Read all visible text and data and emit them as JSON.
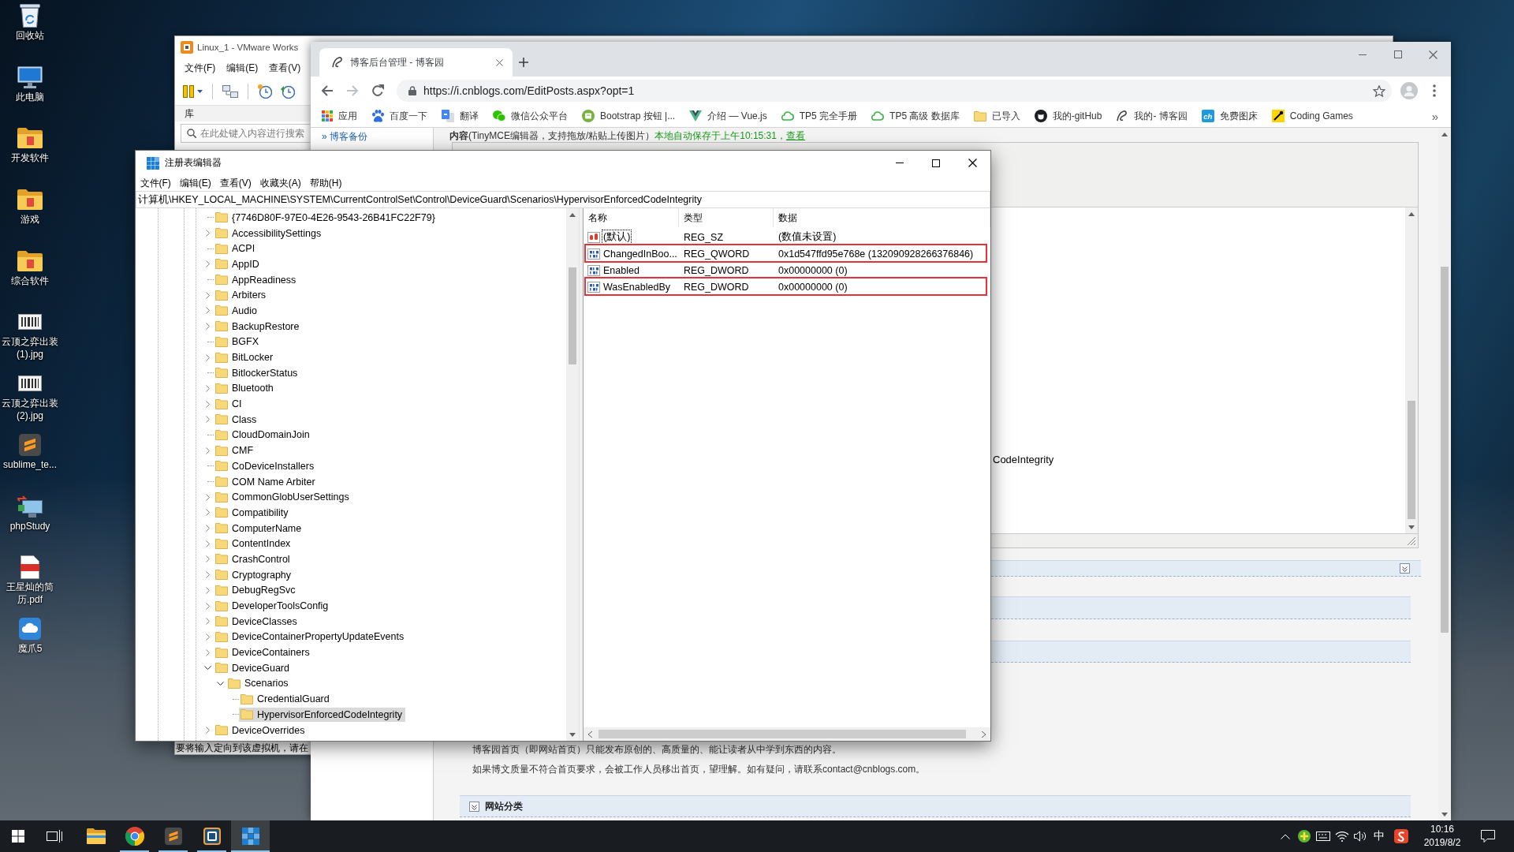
{
  "desktop": {
    "icons": [
      {
        "label": "回收站",
        "kind": "bin"
      },
      {
        "label": "此电脑",
        "kind": "computer"
      },
      {
        "label": "开发软件",
        "kind": "folder"
      },
      {
        "label": "游戏",
        "kind": "folder"
      },
      {
        "label": "综合软件",
        "kind": "folder"
      },
      {
        "label": "云顶之弈出装(1).jpg",
        "kind": "image"
      },
      {
        "label": "云顶之弈出装(2).jpg",
        "kind": "image"
      },
      {
        "label": "sublime_te...",
        "kind": "sublime"
      },
      {
        "label": "phpStudy",
        "kind": "phpstudy"
      },
      {
        "label": "王星灿的简历.pdf",
        "kind": "pdf"
      },
      {
        "label": "魔爪5",
        "kind": "cloud"
      }
    ]
  },
  "vmware": {
    "title": "Linux_1 - VMware Works",
    "menu": [
      "文件(F)",
      "编辑(E)",
      "查看(V)"
    ],
    "library_title": "库",
    "search": {
      "placeholder": "在此处键入内容进行搜索"
    },
    "status": "要将输入定向到该虚拟机，请在"
  },
  "browser": {
    "tabs": [
      {
        "title": "博客后台管理 - 博客园",
        "selected": true
      }
    ],
    "nav": [
      {
        "kind": "back",
        "disabled": false
      },
      {
        "kind": "forward",
        "disabled": true
      },
      {
        "kind": "reload",
        "disabled": false
      }
    ],
    "url": "https://i.cnblogs.com/EditPosts.aspx?opt=1",
    "bookmarks": [
      {
        "label": "应用",
        "kind": "apps"
      },
      {
        "label": "百度一下",
        "kind": "paw"
      },
      {
        "label": "翻译",
        "kind": "translate"
      },
      {
        "label": "微信公众平台",
        "kind": "chat"
      },
      {
        "label": "Bootstrap 按钮 |...",
        "kind": "page"
      },
      {
        "label": "介绍 — Vue.js",
        "kind": "vee"
      },
      {
        "label": "TP5 完全手册",
        "kind": "cloud"
      },
      {
        "label": "TP5 高级 数据库",
        "kind": "cloud"
      },
      {
        "label": "已导入",
        "kind": "folder"
      },
      {
        "label": "我的-gitHub",
        "kind": "cat"
      },
      {
        "label": "我的- 博客园",
        "kind": "site"
      },
      {
        "label": "免费图床",
        "kind": "tile",
        "icon_text": "ch"
      },
      {
        "label": "Coding Games",
        "kind": "pin"
      }
    ],
    "more_bookmarks": "»",
    "page": {
      "sidebar_links": [
        "» 博客备份"
      ],
      "editor_label": "**内容**(TinyMCE编辑器，支持拖放/粘贴上传图片）",
      "autosave_note": "本地自动保存于上午10:15:31，",
      "autosave_link": "查看",
      "editor_text": "CodeIntegrity",
      "notices": [
        "博客园首页（即网站首页）只能发布原创的、高质量的、能让读者从中学到东西的内容。",
        "如果博文质量不符合首页要求，会被工作人员移出首页，望理解。如有疑问，请联系contact@cnblogs.com。"
      ],
      "category_title": "网站分类"
    }
  },
  "regedit": {
    "title": "注册表编辑器",
    "menu": [
      "文件(F)",
      "编辑(E)",
      "查看(V)",
      "收藏夹(A)",
      "帮助(H)"
    ],
    "address": "计算机\\HKEY_LOCAL_MACHINE\\SYSTEM\\CurrentControlSet\\Control\\DeviceGuard\\Scenarios\\HypervisorEnforcedCodeIntegrity",
    "tree": [
      {
        "name": "{7746D80F-97E0-4E26-9543-26B41FC22F79}",
        "expandable": false,
        "selected": false
      },
      {
        "name": "AccessibilitySettings",
        "expandable": true,
        "expanded": false,
        "selected": false
      },
      {
        "name": "ACPI",
        "expandable": false,
        "selected": false
      },
      {
        "name": "AppID",
        "expandable": true,
        "expanded": false,
        "selected": false
      },
      {
        "name": "AppReadiness",
        "expandable": false,
        "selected": false
      },
      {
        "name": "Arbiters",
        "expandable": true,
        "expanded": false,
        "selected": false
      },
      {
        "name": "Audio",
        "expandable": true,
        "expanded": false,
        "selected": false
      },
      {
        "name": "BackupRestore",
        "expandable": true,
        "expanded": false,
        "selected": false
      },
      {
        "name": "BGFX",
        "expandable": false,
        "selected": false
      },
      {
        "name": "BitLocker",
        "expandable": true,
        "expanded": false,
        "selected": false
      },
      {
        "name": "BitlockerStatus",
        "expandable": false,
        "selected": false
      },
      {
        "name": "Bluetooth",
        "expandable": true,
        "expanded": false,
        "selected": false
      },
      {
        "name": "CI",
        "expandable": true,
        "expanded": false,
        "selected": false
      },
      {
        "name": "Class",
        "expandable": true,
        "expanded": false,
        "selected": false
      },
      {
        "name": "CloudDomainJoin",
        "expandable": false,
        "selected": false
      },
      {
        "name": "CMF",
        "expandable": true,
        "expanded": false,
        "selected": false
      },
      {
        "name": "CoDeviceInstallers",
        "expandable": false,
        "selected": false
      },
      {
        "name": "COM Name Arbiter",
        "expandable": false,
        "selected": false
      },
      {
        "name": "CommonGlobUserSettings",
        "expandable": true,
        "expanded": false,
        "selected": false
      },
      {
        "name": "Compatibility",
        "expandable": true,
        "expanded": false,
        "selected": false
      },
      {
        "name": "ComputerName",
        "expandable": true,
        "expanded": false,
        "selected": false
      },
      {
        "name": "ContentIndex",
        "expandable": true,
        "expanded": false,
        "selected": false
      },
      {
        "name": "CrashControl",
        "expandable": true,
        "expanded": false,
        "selected": false
      },
      {
        "name": "Cryptography",
        "expandable": true,
        "expanded": false,
        "selected": false
      },
      {
        "name": "DebugRegSvc",
        "expandable": true,
        "expanded": false,
        "selected": false
      },
      {
        "name": "DeveloperToolsConfig",
        "expandable": true,
        "expanded": false,
        "selected": false
      },
      {
        "name": "DeviceClasses",
        "expandable": true,
        "expanded": false,
        "selected": false
      },
      {
        "name": "DeviceContainerPropertyUpdateEvents",
        "expandable": true,
        "expanded": false,
        "selected": false
      },
      {
        "name": "DeviceContainers",
        "expandable": true,
        "expanded": false,
        "selected": false
      },
      {
        "name": "DeviceGuard",
        "expandable": true,
        "expanded": true,
        "selected": false,
        "children": [
          {
            "name": "Scenarios",
            "expandable": true,
            "expanded": true,
            "selected": false,
            "children": [
              {
                "name": "CredentialGuard",
                "expandable": false,
                "selected": false
              },
              {
                "name": "HypervisorEnforcedCodeIntegrity",
                "expandable": false,
                "selected": true
              }
            ]
          }
        ]
      },
      {
        "name": "DeviceOverrides",
        "expandable": true,
        "expanded": false,
        "selected": false
      }
    ],
    "columns": [
      "名称",
      "类型",
      "数据"
    ],
    "values": [
      {
        "kind": "string",
        "name": "(默认)",
        "type": "REG_SZ",
        "data": "(数值未设置)",
        "focused": true,
        "annotated": false
      },
      {
        "kind": "binary",
        "name": "ChangedInBoo...",
        "type": "REG_QWORD",
        "data": "0x1d547ffd95e768e (132090928266376846)",
        "focused": false,
        "annotated": true
      },
      {
        "kind": "binary",
        "name": "Enabled",
        "type": "REG_DWORD",
        "data": "0x00000000 (0)",
        "focused": false,
        "annotated": false
      },
      {
        "kind": "binary",
        "name": "WasEnabledBy",
        "type": "REG_DWORD",
        "data": "0x00000000 (0)",
        "focused": false,
        "annotated": true
      }
    ]
  },
  "taskbar": {
    "apps": [
      {
        "kind": "explorer",
        "running": false,
        "active": false
      },
      {
        "kind": "browser",
        "running": true,
        "active": false
      },
      {
        "kind": "editor",
        "running": true,
        "active": false
      },
      {
        "kind": "vm",
        "running": true,
        "active": false
      },
      {
        "kind": "registry",
        "running": true,
        "active": true
      }
    ],
    "tray": {
      "input_mode": "中",
      "time": "10:16",
      "date": "2019/8/2"
    }
  }
}
